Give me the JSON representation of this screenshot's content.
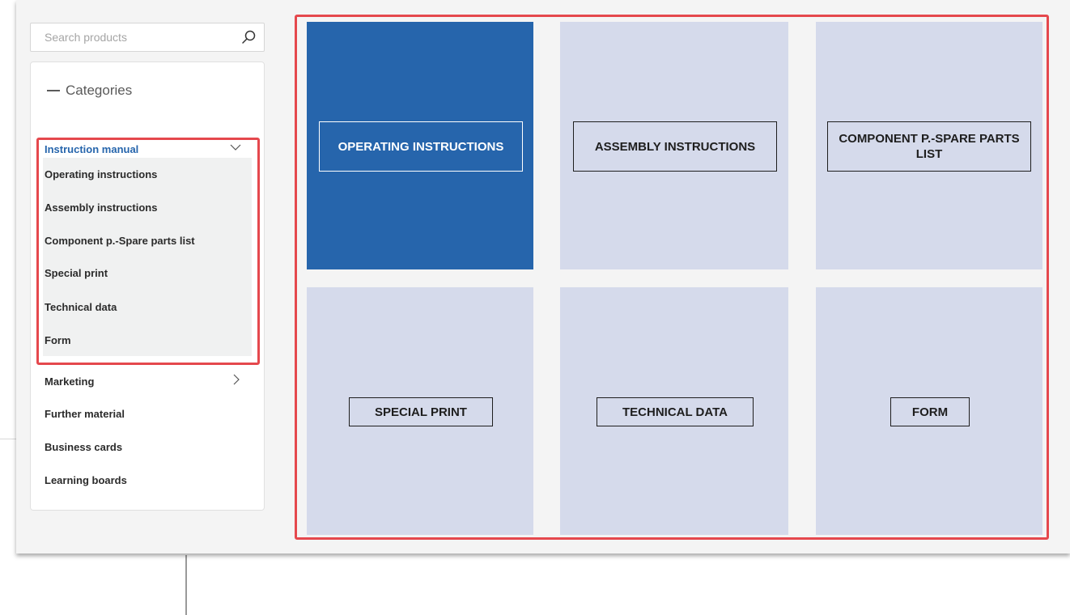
{
  "search": {
    "placeholder": "Search products",
    "icon": "search-icon"
  },
  "sidebar": {
    "title": "Categories",
    "items": [
      {
        "label": "Instruction manual",
        "expanded": true,
        "active": true,
        "icon": "chevron-down-icon"
      },
      {
        "label": "Marketing",
        "expanded": false,
        "icon": "chevron-right-icon"
      },
      {
        "label": "Further material"
      },
      {
        "label": "Business cards"
      },
      {
        "label": "Learning boards"
      }
    ],
    "submenu": [
      "Operating instructions",
      "Assembly instructions",
      "Component p.-Spare parts list",
      "Special print",
      "Technical data",
      "Form"
    ]
  },
  "grid": {
    "tiles": [
      {
        "label": "OPERATING INSTRUCTIONS",
        "active": true
      },
      {
        "label": "ASSEMBLY INSTRUCTIONS"
      },
      {
        "label": "COMPONENT P.-SPARE PARTS LIST"
      },
      {
        "label": "SPECIAL PRINT"
      },
      {
        "label": "TECHNICAL DATA"
      },
      {
        "label": "FORM"
      }
    ]
  },
  "colors": {
    "accent": "#2665ac",
    "tile": "#d5daeb",
    "highlight": "#e5484d",
    "panel": "#f4f4f4"
  }
}
